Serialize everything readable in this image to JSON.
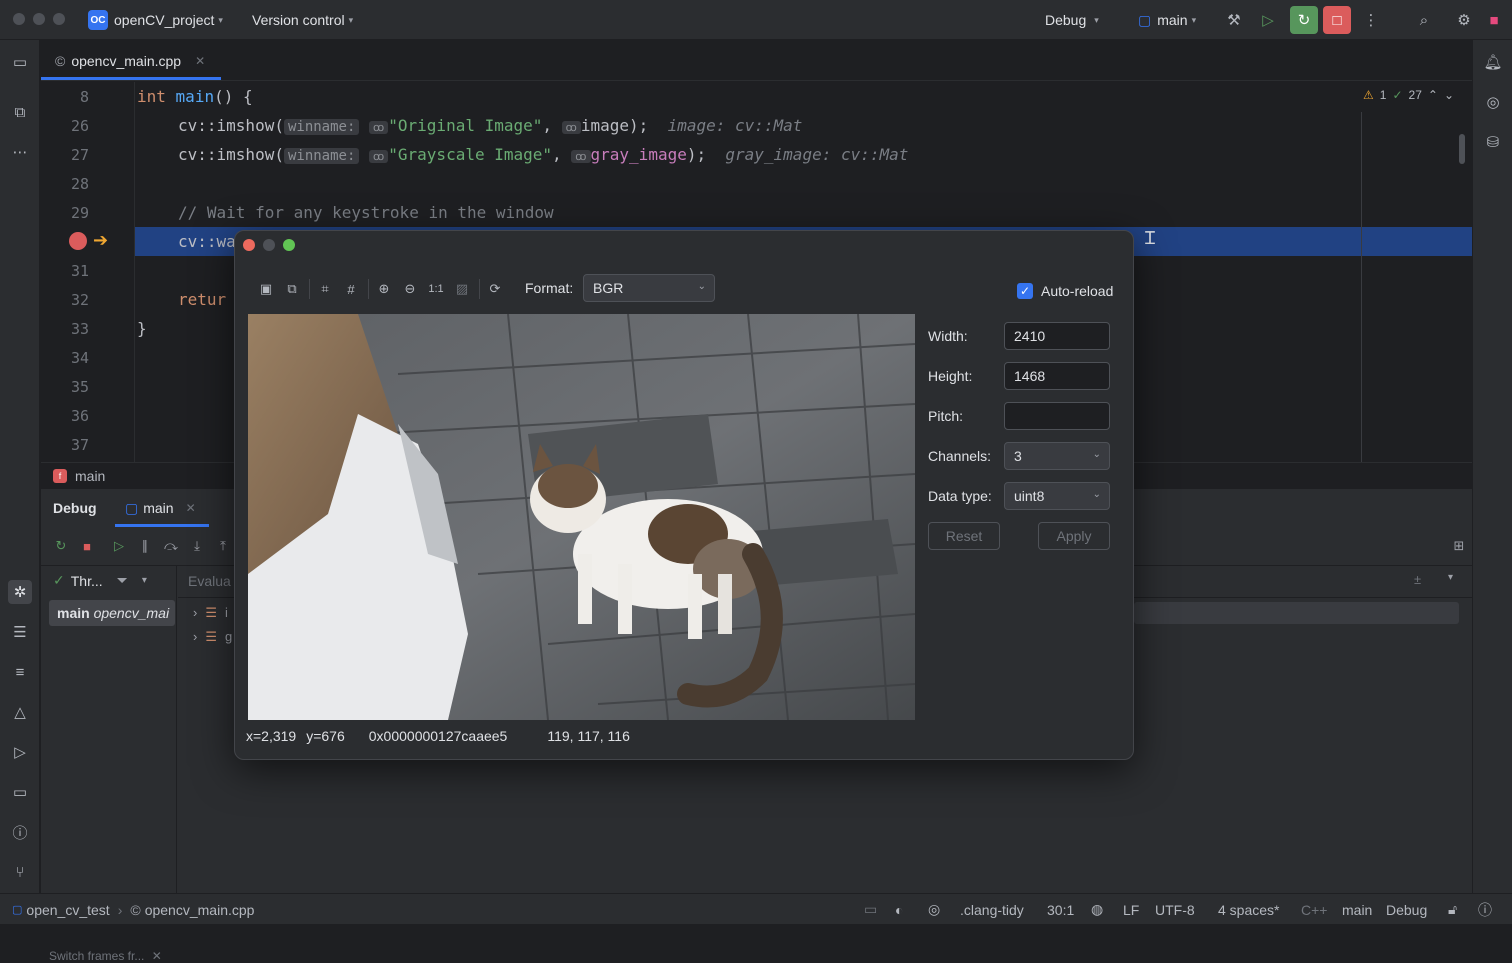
{
  "titlebar": {
    "project_badge": "OC",
    "project_name": "openCV_project",
    "version_control": "Version control",
    "run_config": "Debug",
    "branch": "main"
  },
  "editor": {
    "tab_label": "opencv_main.cpp",
    "warnings": "1",
    "checks": "27",
    "lines": [
      {
        "num": "8"
      },
      {
        "num": "26"
      },
      {
        "num": "27"
      },
      {
        "num": "28"
      },
      {
        "num": "29"
      },
      {
        "num": "31"
      },
      {
        "num": "32"
      },
      {
        "num": "33"
      },
      {
        "num": "34"
      },
      {
        "num": "35"
      },
      {
        "num": "36"
      },
      {
        "num": "37"
      }
    ],
    "code": {
      "l8_kw": "int",
      "l8_fn": "main",
      "l8_rest": "() {",
      "l26_call": "cv::imshow(",
      "l26_hint": "winname:",
      "l26_str": "\"Original Image\"",
      "l26_var": "image",
      "l26_end": ");",
      "l26_inlay": "image: cv::Mat",
      "l27_call": "cv::imshow(",
      "l27_hint": "winname:",
      "l27_str": "\"Grayscale Image\"",
      "l27_var": "gray_image",
      "l27_end": ");",
      "l27_inlay": "gray_image: cv::Mat",
      "l29_comment": "// Wait for any keystroke in the window",
      "l30_code": "cv::wa",
      "l32_code": "retur",
      "l33_code": "}"
    },
    "breadcrumb": "main"
  },
  "debug": {
    "tab_debug": "Debug",
    "tab_main": "main",
    "threads_label": "Thr...",
    "evaluate_label": "Evalua",
    "frame_label": "main",
    "frame_detail": "opencv_mai",
    "var1": "i",
    "var2": "g",
    "switch_frames": "Switch frames fr..."
  },
  "viewer": {
    "format_label": "Format:",
    "format_value": "BGR",
    "auto_reload_label": "Auto-reload",
    "auto_reload_checked": true,
    "width_label": "Width:",
    "width_value": "2410",
    "height_label": "Height:",
    "height_value": "1468",
    "pitch_label": "Pitch:",
    "pitch_value": "",
    "channels_label": "Channels:",
    "channels_value": "3",
    "datatype_label": "Data type:",
    "datatype_value": "uint8",
    "reset_label": "Reset",
    "apply_label": "Apply",
    "zoom_one": "1:1",
    "status_x": "x=2,319",
    "status_y": "y=676",
    "status_addr": "0x0000000127caaee5",
    "status_pixel": "119, 117, 116"
  },
  "statusbar": {
    "project": "open_cv_test",
    "file": "opencv_main.cpp",
    "clang_tidy": ".clang-tidy",
    "position": "30:1",
    "line_ending": "LF",
    "encoding": "UTF-8",
    "indent": "4 spaces*",
    "language": "C++",
    "context": "main",
    "mode": "Debug"
  },
  "colors": {
    "accent": "#3574f0",
    "highlight_row": "#214283",
    "stop_red": "#db5c5c",
    "rerun_green": "#57965c"
  }
}
